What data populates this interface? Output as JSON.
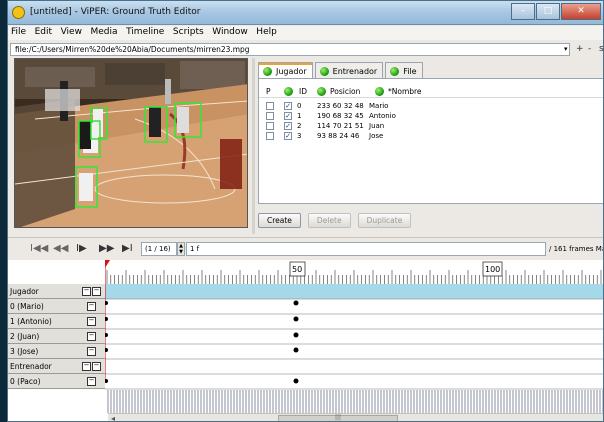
{
  "window": {
    "title": "[untitled] - ViPER: Ground Truth Editor",
    "min_label": "–",
    "max_label": "□",
    "close_label": "✕"
  },
  "menu": [
    "File",
    "Edit",
    "View",
    "Media",
    "Timeline",
    "Scripts",
    "Window",
    "Help"
  ],
  "path": {
    "value": "file:/C:/Users/Mirren%20de%20Abia/Documents/mirren23.mpg",
    "dropdown": "▾",
    "plus": "+",
    "minus": "-",
    "cut": "s"
  },
  "tabs": [
    {
      "label": "Jugador",
      "active": true
    },
    {
      "label": "Entrenador",
      "active": false
    },
    {
      "label": "File",
      "active": false
    }
  ],
  "table": {
    "headers": {
      "p": "P",
      "id": "ID",
      "posicion": "Posicion",
      "nombre": "*Nombre"
    },
    "rows": [
      {
        "id": "0",
        "posicion": "233 60 32 48",
        "nombre": "Mario"
      },
      {
        "id": "1",
        "posicion": "190 68 32 45",
        "nombre": "Antonio"
      },
      {
        "id": "2",
        "posicion": "114 70 21 51",
        "nombre": "Juan"
      },
      {
        "id": "3",
        "posicion": "93 88 24 46",
        "nombre": "Jose"
      }
    ],
    "check": "✓"
  },
  "buttons": {
    "create": "Create",
    "delete": "Delete",
    "duplicate": "Duplicate"
  },
  "playback": {
    "first": "I◀◀",
    "prev": "◀◀",
    "step": "I▶",
    "next": "▶▶",
    "last": "▶I",
    "frame_counter": "(1 / 16)",
    "frame_value": "1 f",
    "total_frames": "/ 161 frames Ma"
  },
  "timeline": {
    "ruler_labels": [
      "50",
      "100"
    ],
    "rows": [
      {
        "label": "Jugador",
        "kind": "descriptor"
      },
      {
        "label": "0 (Mario)",
        "kind": "instance"
      },
      {
        "label": "1 (Antonio)",
        "kind": "instance"
      },
      {
        "label": "2 (Juan)",
        "kind": "instance"
      },
      {
        "label": "3 (Jose)",
        "kind": "instance"
      },
      {
        "label": "Entrenador",
        "kind": "descriptor"
      },
      {
        "label": "0 (Paco)",
        "kind": "instance"
      }
    ],
    "scroll_left": "◂",
    "scroll_grip": "|||"
  }
}
